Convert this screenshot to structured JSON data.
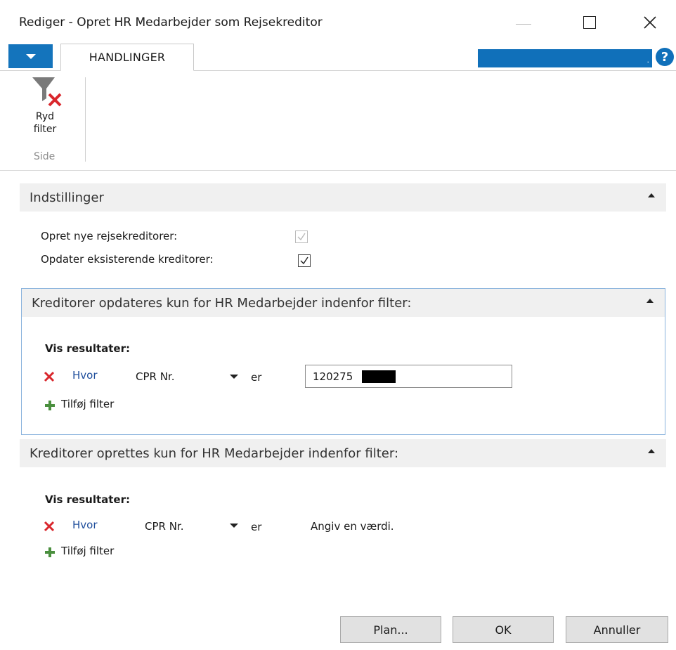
{
  "window": {
    "title": "Rediger - Opret HR Medarbejder som Rejsekreditor"
  },
  "ribbon": {
    "tab_label": "HANDLINGER",
    "bluebar_text": ".",
    "help_glyph": "?",
    "clear_filter_line1": "Ryd",
    "clear_filter_line2": "filter",
    "group_label": "Side"
  },
  "settings": {
    "title": "Indstillinger",
    "create_new_label": "Opret nye rejsekreditorer:",
    "create_new_checked": true,
    "create_new_enabled": false,
    "update_existing_label": "Opdater eksisterende kreditorer:",
    "update_existing_checked": true
  },
  "update_filter": {
    "title": "Kreditorer opdateres kun for HR Medarbejder indenfor filter:",
    "show_results": "Vis resultater:",
    "where": "Hvor",
    "field": "CPR Nr.",
    "operator": "er",
    "value": "120275",
    "add_filter": "Tilføj filter"
  },
  "create_filter": {
    "title": "Kreditorer oprettes kun for HR Medarbejder indenfor filter:",
    "show_results": "Vis resultater:",
    "where": "Hvor",
    "field": "CPR Nr.",
    "operator": "er",
    "value_placeholder": "Angiv en værdi.",
    "add_filter": "Tilføj filter"
  },
  "buttons": {
    "plan": "Plan...",
    "ok": "OK",
    "cancel": "Annuller"
  },
  "colors": {
    "accent": "#1070ba",
    "link": "#1f4e9c",
    "remove": "#d9262c",
    "add": "#4a8f3e",
    "section_bg": "#f0f0f0"
  }
}
